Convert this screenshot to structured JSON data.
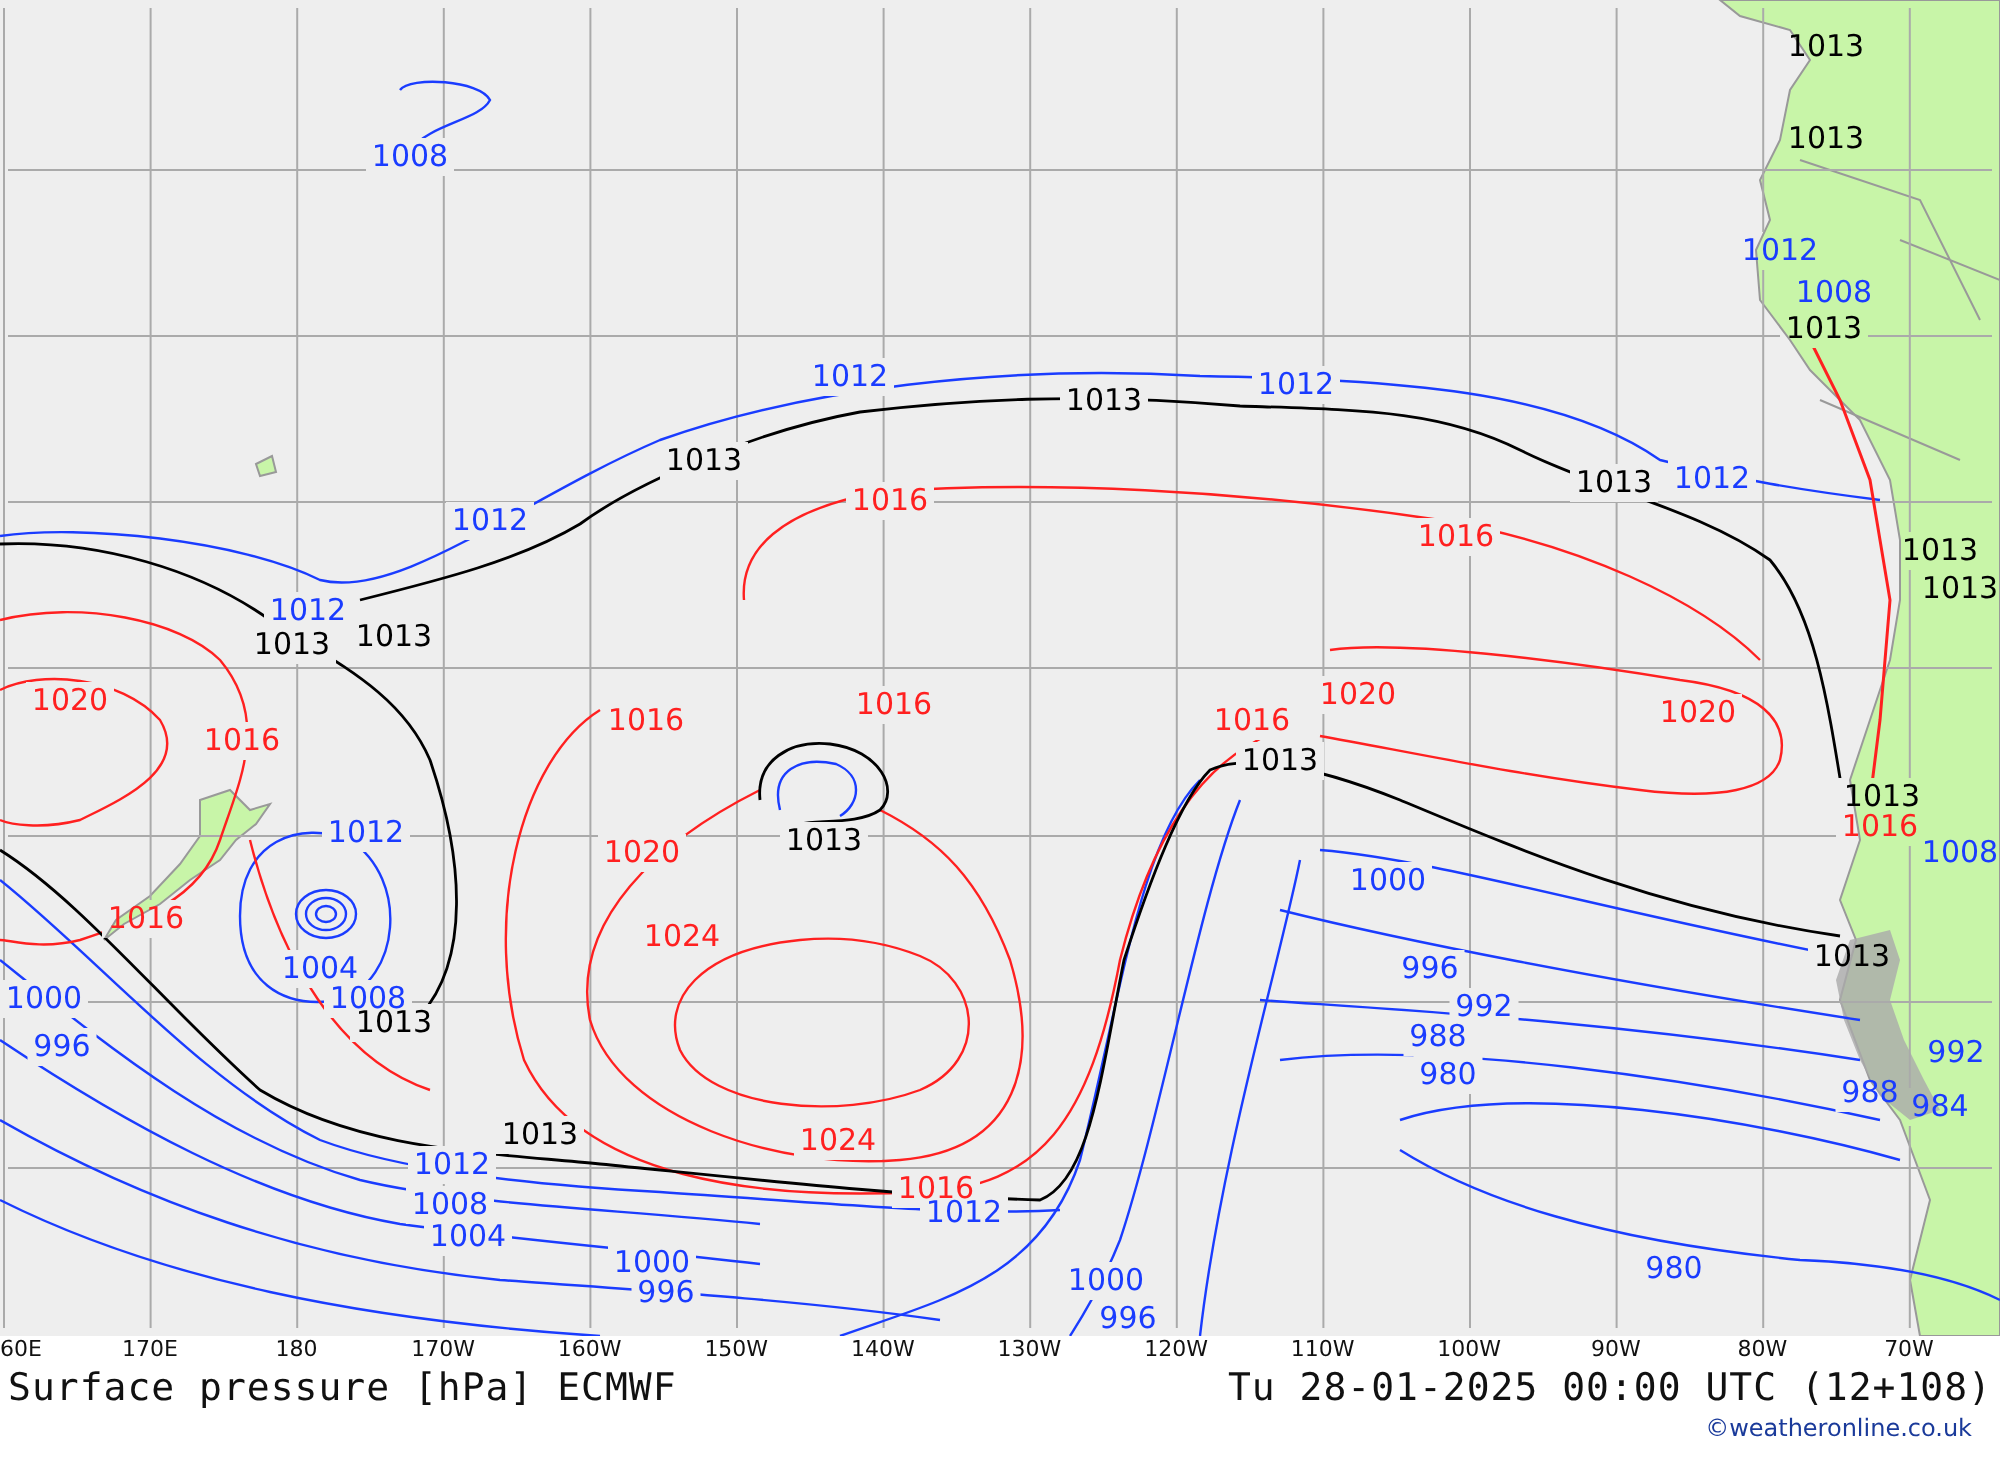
{
  "map": {
    "contour_labels": [
      {
        "text": "1013",
        "kind": "mid"
      },
      {
        "text": "1008",
        "kind": "low"
      },
      {
        "text": "1013",
        "kind": "mid"
      },
      {
        "text": "1012",
        "kind": "low"
      },
      {
        "text": "1008",
        "kind": "low"
      },
      {
        "text": "1013",
        "kind": "mid"
      },
      {
        "text": "1012",
        "kind": "low"
      },
      {
        "text": "1012",
        "kind": "low"
      },
      {
        "text": "1013",
        "kind": "mid"
      },
      {
        "text": "1013",
        "kind": "mid"
      },
      {
        "text": "1012",
        "kind": "low"
      },
      {
        "text": "1013",
        "kind": "mid"
      },
      {
        "text": "1016",
        "kind": "high"
      },
      {
        "text": "1012",
        "kind": "low"
      },
      {
        "text": "1016",
        "kind": "high"
      },
      {
        "text": "1013",
        "kind": "mid"
      },
      {
        "text": "1013",
        "kind": "mid"
      },
      {
        "text": "1012",
        "kind": "low"
      },
      {
        "text": "1013",
        "kind": "mid"
      },
      {
        "text": "1013",
        "kind": "mid"
      },
      {
        "text": "1020",
        "kind": "high"
      },
      {
        "text": "1016",
        "kind": "high"
      },
      {
        "text": "1016",
        "kind": "high"
      },
      {
        "text": "1016",
        "kind": "high"
      },
      {
        "text": "1016",
        "kind": "high"
      },
      {
        "text": "1020",
        "kind": "high"
      },
      {
        "text": "1020",
        "kind": "high"
      },
      {
        "text": "1013",
        "kind": "mid"
      },
      {
        "text": "1013",
        "kind": "mid"
      },
      {
        "text": "1012",
        "kind": "low"
      },
      {
        "text": "1020",
        "kind": "high"
      },
      {
        "text": "1013",
        "kind": "mid"
      },
      {
        "text": "1016",
        "kind": "high"
      },
      {
        "text": "1008",
        "kind": "low"
      },
      {
        "text": "1000",
        "kind": "low"
      },
      {
        "text": "1016",
        "kind": "high"
      },
      {
        "text": "1024",
        "kind": "high"
      },
      {
        "text": "1004",
        "kind": "low"
      },
      {
        "text": "996",
        "kind": "low"
      },
      {
        "text": "1013",
        "kind": "mid"
      },
      {
        "text": "1000",
        "kind": "low"
      },
      {
        "text": "1008",
        "kind": "low"
      },
      {
        "text": "992",
        "kind": "low"
      },
      {
        "text": "1013",
        "kind": "mid"
      },
      {
        "text": "988",
        "kind": "low"
      },
      {
        "text": "996",
        "kind": "low"
      },
      {
        "text": "992",
        "kind": "low"
      },
      {
        "text": "980",
        "kind": "low"
      },
      {
        "text": "988",
        "kind": "low"
      },
      {
        "text": "984",
        "kind": "low"
      },
      {
        "text": "1013",
        "kind": "mid"
      },
      {
        "text": "1024",
        "kind": "high"
      },
      {
        "text": "1012",
        "kind": "low"
      },
      {
        "text": "1016",
        "kind": "high"
      },
      {
        "text": "1008",
        "kind": "low"
      },
      {
        "text": "1012",
        "kind": "low"
      },
      {
        "text": "1004",
        "kind": "low"
      },
      {
        "text": "1000",
        "kind": "low"
      },
      {
        "text": "980",
        "kind": "low"
      },
      {
        "text": "1000",
        "kind": "low"
      },
      {
        "text": "996",
        "kind": "low"
      },
      {
        "text": "996",
        "kind": "low"
      }
    ],
    "longitude_labels": [
      "60E",
      "170E",
      "180",
      "170W",
      "160W",
      "150W",
      "140W",
      "130W",
      "120W",
      "110W",
      "100W",
      "90W",
      "80W",
      "70W"
    ]
  },
  "title": "Surface pressure [hPa] ECMWF",
  "valid_time": "Tu 28-01-2025 00:00 UTC (12+108)",
  "credit": "©weatheronline.co.uk"
}
